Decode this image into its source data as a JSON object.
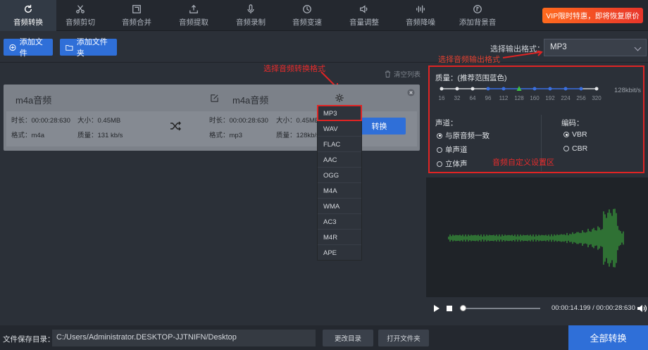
{
  "tabs": [
    {
      "label": "音频转换",
      "icon": "refresh-icon",
      "active": true
    },
    {
      "label": "音频剪切",
      "icon": "scissors-icon"
    },
    {
      "label": "音频合并",
      "icon": "merge-icon"
    },
    {
      "label": "音频提取",
      "icon": "extract-icon"
    },
    {
      "label": "音频录制",
      "icon": "microphone-icon"
    },
    {
      "label": "音频变速",
      "icon": "clock-icon"
    },
    {
      "label": "音量调整",
      "icon": "volume-icon"
    },
    {
      "label": "音频降噪",
      "icon": "denoise-icon"
    },
    {
      "label": "添加背景音",
      "icon": "music-note-icon"
    }
  ],
  "vip_banner": "VIP限时特惠，即将恢复原价",
  "toolbar": {
    "add_file": "添加文件",
    "add_folder": "添加文件夹",
    "format_label": "选择输出格式：",
    "format_value": "MP3"
  },
  "file_list": {
    "clear_label": "清空列表",
    "item": {
      "src_name": "m4a音频",
      "src_duration": "时长：00:00:28:630",
      "src_size": "大小：0.45MB",
      "src_format": "格式：m4a",
      "src_quality": "质量：131 kb/s",
      "dst_name": "m4a音频",
      "dst_duration": "时长：00:00:28:630",
      "dst_size": "大小：0.45MB",
      "dst_format": "格式：mp3",
      "dst_quality": "质量：128kb/s",
      "convert_label": "转换"
    }
  },
  "format_dropdown": [
    "MP3",
    "WAV",
    "FLAC",
    "AAC",
    "OGG",
    "M4A",
    "WMA",
    "AC3",
    "M4R",
    "APE"
  ],
  "annotations": {
    "format_select": "选择音频输出格式",
    "per_file_format": "选择音频转换格式",
    "custom_area": "音频自定义设置区"
  },
  "settings": {
    "quality_label": "质量：(推荐范围蓝色)",
    "quality_value": "128kbit/s",
    "ticks": [
      "16",
      "32",
      "64",
      "96",
      "112",
      "128",
      "160",
      "192",
      "224",
      "256",
      "320"
    ],
    "selected_index": 5,
    "channel_label": "声道：",
    "channel_options": [
      "与原音频一致",
      "单声道",
      "立体声"
    ],
    "channel_selected": 0,
    "encoding_label": "编码：",
    "encoding_options": [
      "VBR",
      "CBR"
    ],
    "encoding_selected": 0
  },
  "player": {
    "time": "00:00:14.199 / 00:00:28:630",
    "progress": 0.0
  },
  "bottom": {
    "save_label": "文件保存目录：",
    "path": "C:/Users/Administrator.DESKTOP-JJTNIFN/Desktop",
    "change_dir": "更改目录",
    "open_folder": "打开文件夹",
    "convert_all": "全部转换"
  },
  "colors": {
    "accent": "#2f6fd8",
    "annotation": "#e02424",
    "wave": "#3fbf3f",
    "vip": "#ff6a1e"
  }
}
